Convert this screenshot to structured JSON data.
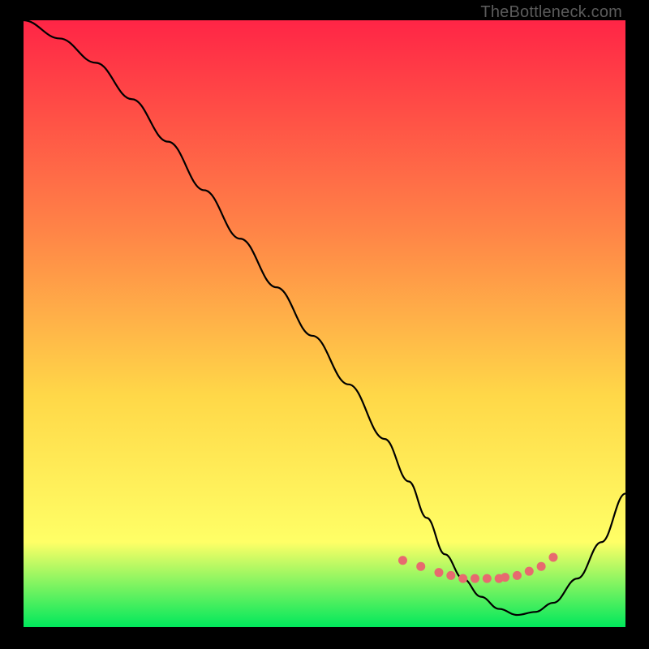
{
  "watermark": "TheBottleneck.com",
  "colors": {
    "bg": "#000000",
    "gradient_top": "#ff2546",
    "gradient_mid1": "#ff8547",
    "gradient_mid2": "#ffd848",
    "gradient_mid3": "#ffff66",
    "gradient_bottom": "#00e85c",
    "curve": "#000000",
    "marker": "#e76a6f"
  },
  "chart_data": {
    "type": "line",
    "title": "",
    "xlabel": "",
    "ylabel": "",
    "xlim": [
      0,
      100
    ],
    "ylim": [
      0,
      100
    ],
    "series": [
      {
        "name": "bottleneck-curve",
        "x": [
          0,
          6,
          12,
          18,
          24,
          30,
          36,
          42,
          48,
          54,
          60,
          64,
          67,
          70,
          73,
          76,
          79,
          82,
          85,
          88,
          92,
          96,
          100
        ],
        "values": [
          100,
          97,
          93,
          87,
          80,
          72,
          64,
          56,
          48,
          40,
          31,
          24,
          18,
          12,
          8,
          5,
          3,
          2,
          2.5,
          4,
          8,
          14,
          22
        ]
      }
    ],
    "markers": {
      "name": "highlight-band",
      "x": [
        63,
        66,
        69,
        71,
        73,
        75,
        77,
        79,
        80,
        82,
        84,
        86,
        88
      ],
      "values": [
        11,
        10,
        9,
        8.5,
        8,
        8,
        8,
        8,
        8.2,
        8.5,
        9.2,
        10,
        11.5
      ]
    }
  }
}
